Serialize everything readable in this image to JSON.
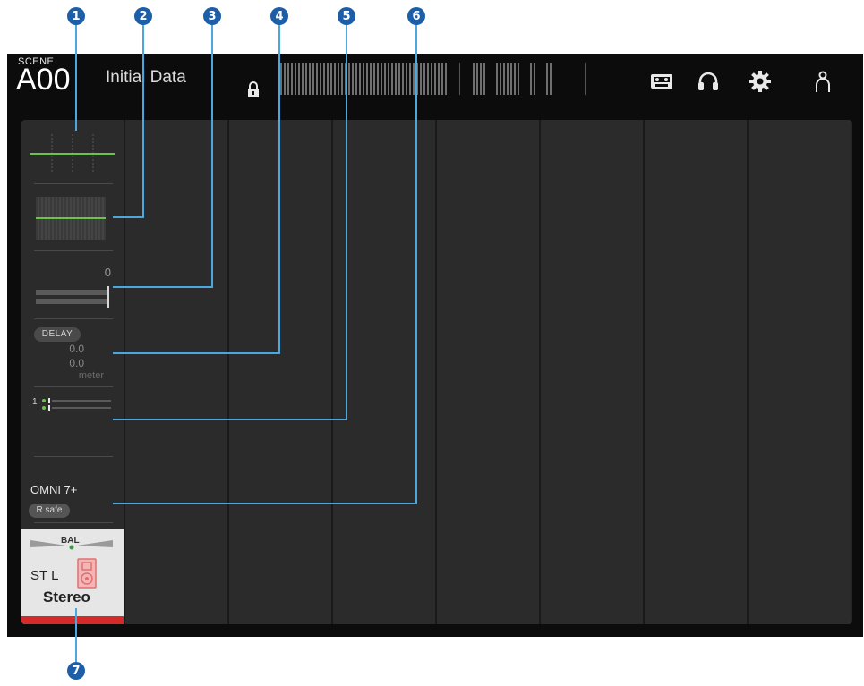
{
  "callouts": [
    "1",
    "2",
    "3",
    "4",
    "5",
    "6",
    "7"
  ],
  "header": {
    "scene_label": "SCENE",
    "scene_number": "A00",
    "scene_name": "Initial Data"
  },
  "icons": [
    "lock-icon",
    "recorder-icon",
    "headphones-icon",
    "settings-icon",
    "user-icon"
  ],
  "channel": {
    "gain_value": "0",
    "delay_label": "DELAY",
    "delay_value_1": "0.0",
    "delay_value_2": "0.0",
    "delay_unit": "meter",
    "bus_number": "1",
    "output_port": "OMNI 7+",
    "recall_safe": "R safe",
    "pan_label": "BAL",
    "channel_id": "ST L",
    "channel_name": "Stereo"
  },
  "colors": {
    "eq_curve": "#6cc24a",
    "name_strip": "#d42a2a",
    "callout": "#1d5ea8",
    "callout_line": "#4aa8e0"
  }
}
